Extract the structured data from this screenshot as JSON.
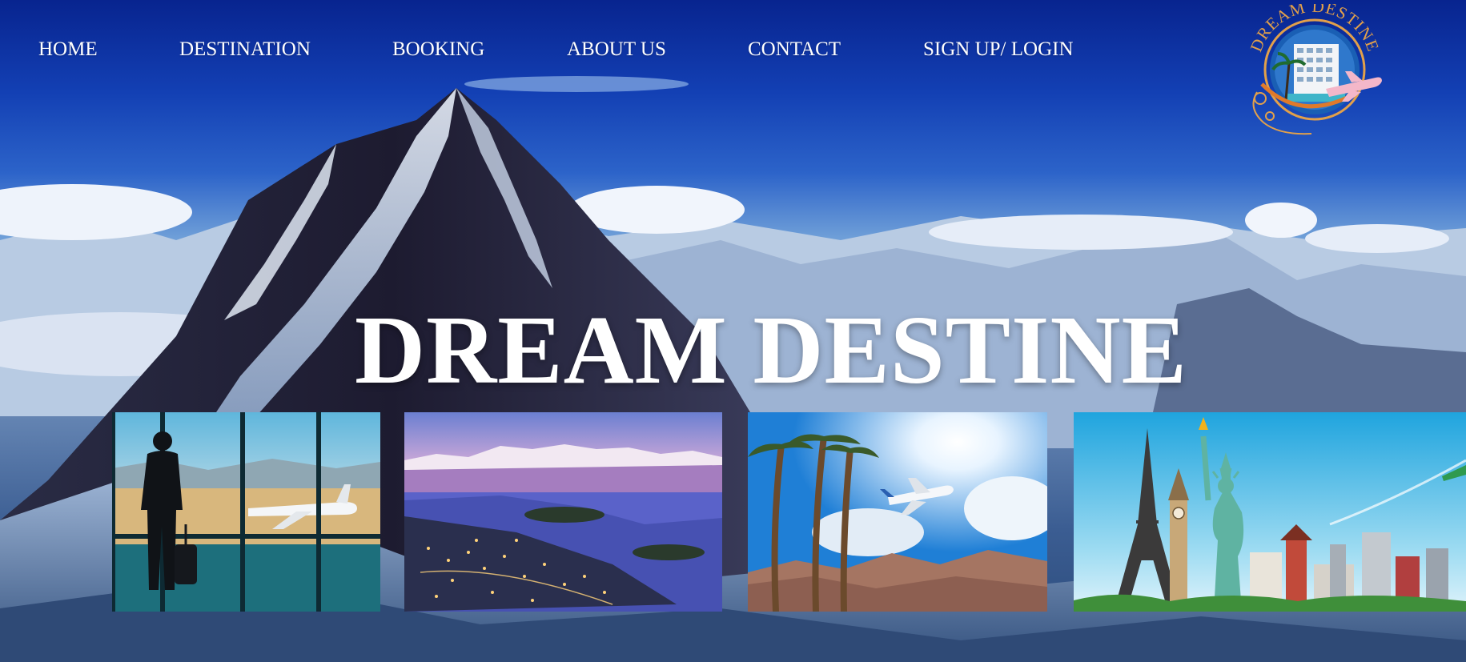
{
  "nav": {
    "items": [
      {
        "label": "HOME"
      },
      {
        "label": "DESTINATION"
      },
      {
        "label": "BOOKING"
      },
      {
        "label": "ABOUT US"
      },
      {
        "label": "CONTACT"
      },
      {
        "label": "SIGN UP/ LOGIN"
      }
    ]
  },
  "logo": {
    "text": "DREAM DESTINE",
    "icon": "hotel-airplane-emblem"
  },
  "hero": {
    "title": "DREAM DESTINE",
    "background": "snowy-mountain-peak-above-clouds"
  },
  "gallery": {
    "items": [
      {
        "image": "traveler-at-airport-window"
      },
      {
        "image": "lakeside-town-at-dusk"
      },
      {
        "image": "palm-trees-airplane-sun"
      },
      {
        "image": "world-landmarks-collage"
      }
    ]
  },
  "colors": {
    "sky_top": "#08248f",
    "text": "#ffffff",
    "logo_gold": "#e2a04a"
  }
}
